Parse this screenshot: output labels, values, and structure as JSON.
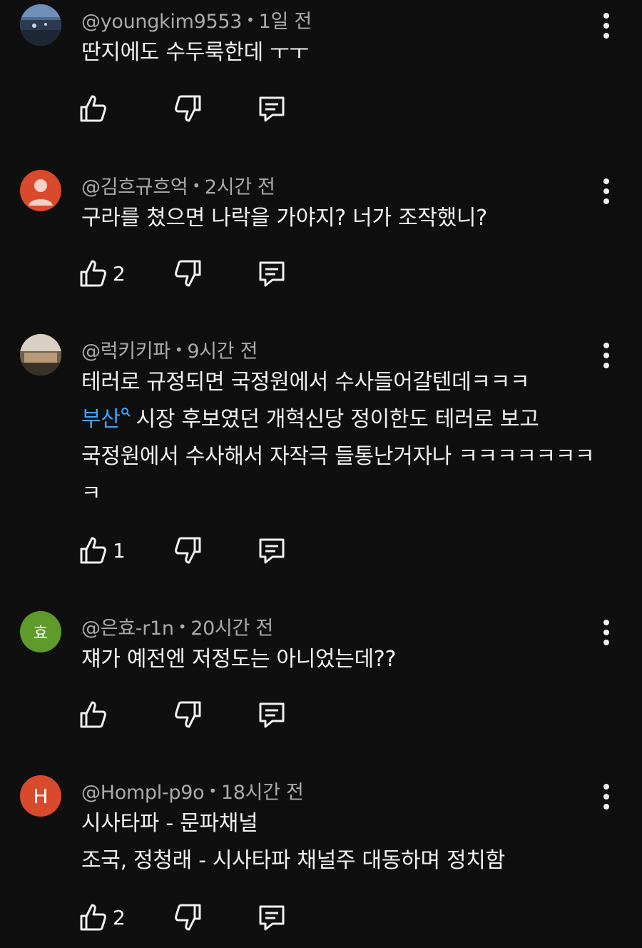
{
  "comments": [
    {
      "author": "@youngkim9553",
      "time": "1일 전",
      "lines": [
        "딴지에도 수두룩한데 ㅜㅜ"
      ],
      "likes": "",
      "avatar": {
        "type": "image",
        "color": "#3a4e6b"
      }
    },
    {
      "author": "@김흐규흐억",
      "time": "2시간 전",
      "lines": [
        "구라를 쳤으면 나락을 가야지? 너가 조작했니?"
      ],
      "likes": "2",
      "avatar": {
        "type": "person",
        "color": "#d84a2b"
      }
    },
    {
      "author": "@럭키키파",
      "time": "9시간 전",
      "line1": "테러로 규정되면  국정원에서 수사들어갈텐데ㅋㅋㅋ",
      "link_text": "부산",
      "line2_rest": "시장 후보였던  개혁신당 정이한도 테러로 보고",
      "line3": "국정원에서 수사해서 자작극 들통난거자나 ㅋㅋㅋㅋㅋㅋㅋ",
      "line4": "ㅋ",
      "likes": "1",
      "avatar": {
        "type": "image",
        "color": "#8a7a66"
      }
    },
    {
      "author": "@은효-r1n",
      "time": "20시간 전",
      "lines": [
        "쟤가 예전엔 저정도는 아니었는데??"
      ],
      "likes": "",
      "avatar": {
        "type": "letter",
        "letter": "효",
        "color": "#5e9b2b"
      }
    },
    {
      "author": "@Hompl-p9o",
      "time": "18시간 전",
      "lines": [
        "시사타파 - 문파채널",
        "조국, 정청래 - 시사타파 채널주 대동하며 정치함"
      ],
      "likes": "2",
      "avatar": {
        "type": "letter",
        "letter": "H",
        "color": "#d84a2b"
      }
    }
  ],
  "separator": "•"
}
